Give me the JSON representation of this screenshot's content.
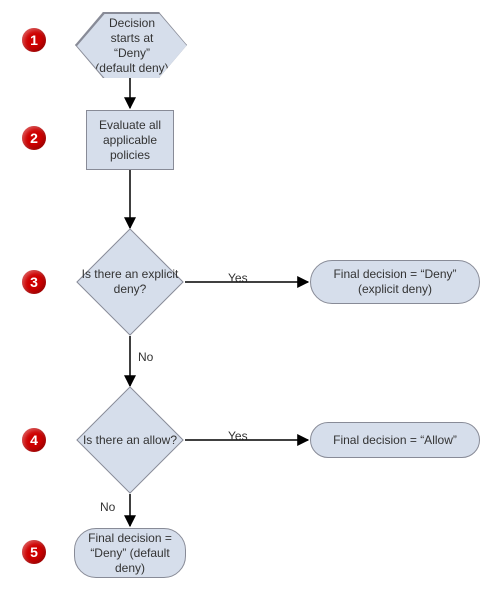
{
  "chart_data": {
    "type": "flowchart",
    "title": "",
    "nodes": [
      {
        "id": "n1",
        "step": 1,
        "shape": "hexagon",
        "text": "Decision starts at “Deny” (default deny)"
      },
      {
        "id": "n2",
        "step": 2,
        "shape": "rectangle",
        "text": "Evaluate all applicable policies"
      },
      {
        "id": "n3",
        "step": 3,
        "shape": "diamond",
        "text": "Is there an explicit deny?"
      },
      {
        "id": "r3",
        "step": 3,
        "shape": "terminator",
        "text": "Final decision = “Deny” (explicit deny)"
      },
      {
        "id": "n4",
        "step": 4,
        "shape": "diamond",
        "text": "Is there an allow?"
      },
      {
        "id": "r4",
        "step": 4,
        "shape": "terminator",
        "text": "Final decision = “Allow”"
      },
      {
        "id": "n5",
        "step": 5,
        "shape": "terminator",
        "text": "Final decision = “Deny” (default deny)"
      }
    ],
    "edges": [
      {
        "from": "n1",
        "to": "n2",
        "label": ""
      },
      {
        "from": "n2",
        "to": "n3",
        "label": ""
      },
      {
        "from": "n3",
        "to": "r3",
        "label": "Yes"
      },
      {
        "from": "n3",
        "to": "n4",
        "label": "No"
      },
      {
        "from": "n4",
        "to": "r4",
        "label": "Yes"
      },
      {
        "from": "n4",
        "to": "n5",
        "label": "No"
      }
    ]
  },
  "badges": {
    "b1": "1",
    "b2": "2",
    "b3": "3",
    "b4": "4",
    "b5": "5"
  },
  "labels": {
    "n3_yes": "Yes",
    "n3_no": "No",
    "n4_yes": "Yes",
    "n4_no": "No"
  },
  "nodes_text": {
    "n1": "Decision starts at “Deny” (default deny)",
    "n2": "Evaluate all applicable policies",
    "n3": "Is there an explicit deny?",
    "r3": "Final decision = “Deny” (explicit deny)",
    "n4": "Is there an allow?",
    "r4": "Final decision = “Allow”",
    "n5": "Final decision = “Deny” (default deny)"
  }
}
